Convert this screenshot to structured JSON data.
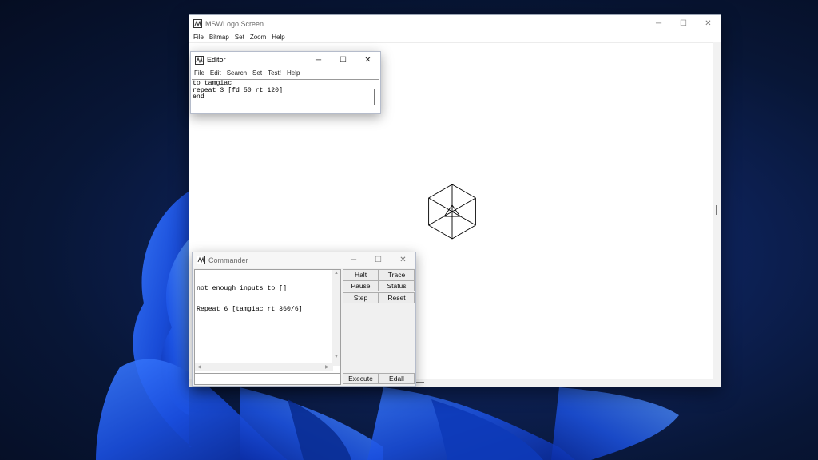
{
  "main_window": {
    "title": "MSWLogo Screen",
    "menu": [
      "File",
      "Bitmap",
      "Set",
      "Zoom",
      "Help"
    ]
  },
  "editor_window": {
    "title": "Editor",
    "menu": [
      "File",
      "Edit",
      "Search",
      "Set",
      "Test!",
      "Help"
    ],
    "lines": [
      "to tamgiac",
      "repeat 3 [fd 50 rt 120]",
      "end"
    ]
  },
  "commander_window": {
    "title": "Commander",
    "output_lines": [
      "not enough inputs to []",
      "Repeat 6 [tamgiac rt 360/6]"
    ],
    "input_value": "",
    "buttons": {
      "halt": "Halt",
      "trace": "Trace",
      "pause": "Pause",
      "status": "Status",
      "step": "Step",
      "reset": "Reset",
      "execute": "Execute",
      "edall": "Edall"
    }
  },
  "colors": {
    "desktop_bg": "#0d2156",
    "wallpaper_bloom": "#1f5ff0",
    "window_bg": "#ffffff",
    "commander_bg": "#f0f0f0"
  },
  "icons": {
    "caption_minimize": "─",
    "caption_maximize": "☐",
    "caption_close": "✕"
  }
}
